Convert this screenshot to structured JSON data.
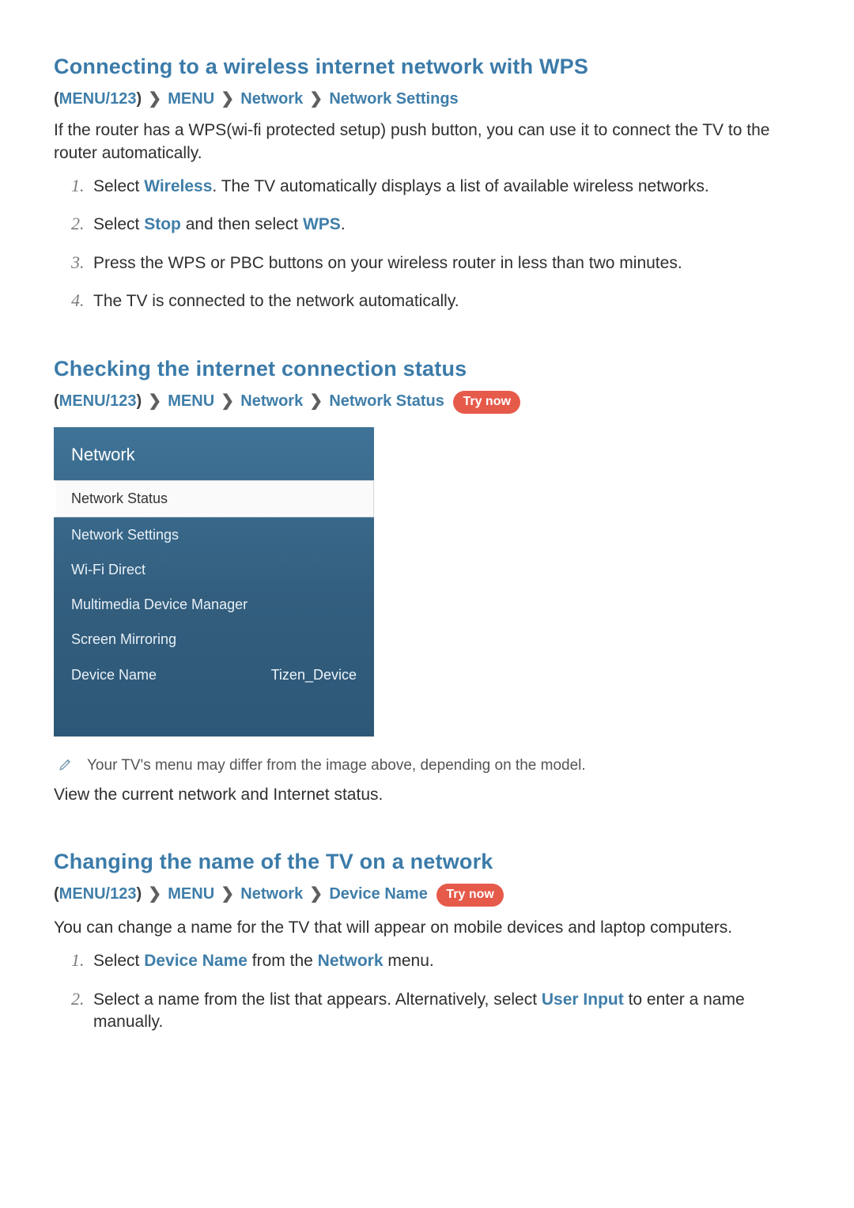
{
  "sections": {
    "wps": {
      "heading": "Connecting to a wireless internet network with WPS",
      "crumbs": [
        "MENU/123",
        "MENU",
        "Network",
        "Network Settings"
      ],
      "intro": "If the router has a WPS(wi-fi protected setup) push button, you can use it to connect the TV to the router automatically.",
      "steps": {
        "s1_a": "Select ",
        "s1_link": "Wireless",
        "s1_b": ". The TV automatically displays a list of available wireless networks.",
        "s2_a": "Select ",
        "s2_link1": "Stop",
        "s2_b": " and then select ",
        "s2_link2": "WPS",
        "s2_c": ".",
        "s3": "Press the WPS or PBC buttons on your wireless router in less than two minutes.",
        "s4": "The TV is connected to the network automatically."
      }
    },
    "status": {
      "heading": "Checking the internet connection status",
      "crumbs": [
        "MENU/123",
        "MENU",
        "Network",
        "Network Status"
      ],
      "try_now": "Try now",
      "menu": {
        "title": "Network",
        "items": [
          {
            "label": "Network Status",
            "selected": true
          },
          {
            "label": "Network Settings"
          },
          {
            "label": "Wi-Fi Direct"
          },
          {
            "label": "Multimedia Device Manager"
          },
          {
            "label": "Screen Mirroring"
          },
          {
            "label": "Device Name",
            "value": "Tizen_Device"
          }
        ]
      },
      "note": "Your TV's menu may differ from the image above, depending on the model.",
      "body": "View the current network and Internet status."
    },
    "devicename": {
      "heading": "Changing the name of the TV on a network",
      "crumbs": [
        "MENU/123",
        "MENU",
        "Network",
        "Device Name"
      ],
      "try_now": "Try now",
      "intro": "You can change a name for the TV that will appear on mobile devices and laptop computers.",
      "steps": {
        "s1_a": "Select ",
        "s1_link1": "Device Name",
        "s1_b": " from the ",
        "s1_link2": "Network",
        "s1_c": " menu.",
        "s2_a": "Select a name from the list that appears. Alternatively, select ",
        "s2_link": "User Input",
        "s2_b": " to enter a name manually."
      }
    }
  }
}
